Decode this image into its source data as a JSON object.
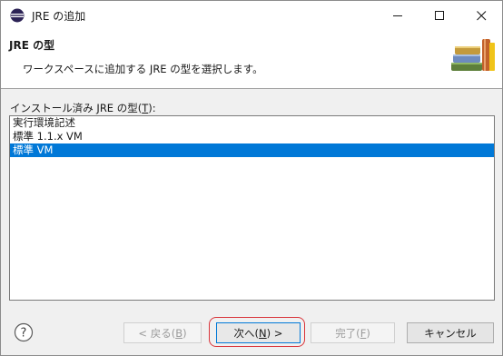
{
  "window": {
    "title": "JRE の追加",
    "controls": [
      "minimize-icon",
      "maximize-icon",
      "close-icon"
    ]
  },
  "banner": {
    "title": "JRE の型",
    "description": "ワークスペースに追加する JRE の型を選択します。",
    "icon": "library-books-icon"
  },
  "list": {
    "label_prefix": "インストール済み JRE の型(",
    "label_mnemonic": "T",
    "label_suffix": "):",
    "items": [
      {
        "label": "実行環境記述",
        "selected": false
      },
      {
        "label": "標準 1.1.x VM",
        "selected": false
      },
      {
        "label": "標準 VM",
        "selected": true
      }
    ]
  },
  "buttons": {
    "back_prefix": "< 戻る(",
    "back_mnemonic": "B",
    "back_suffix": ")",
    "next_prefix": "次へ(",
    "next_mnemonic": "N",
    "next_suffix": ") >",
    "finish_prefix": "完了(",
    "finish_mnemonic": "F",
    "finish_suffix": ")",
    "cancel": "キャンセル",
    "help_icon": "help-icon"
  },
  "colors": {
    "selection": "#0078d7",
    "highlight_ring": "#d9343a"
  }
}
